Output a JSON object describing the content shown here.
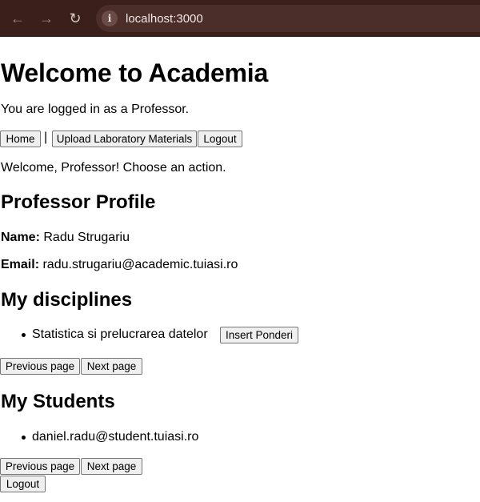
{
  "browser": {
    "url": "localhost:3000",
    "back_icon": "arrow-left-icon",
    "forward_icon": "arrow-right-icon",
    "reload_icon": "reload-icon",
    "info_icon": "info-icon"
  },
  "header": {
    "title": "Welcome to Academia",
    "logged_in_text": "You are logged in as a Professor."
  },
  "nav": {
    "home_label": "Home",
    "separator": "|",
    "upload_label": "Upload Laboratory Materials",
    "logout_label": "Logout"
  },
  "welcome_message": "Welcome, Professor! Choose an action.",
  "profile": {
    "heading": "Professor Profile",
    "name_label": "Name:",
    "name_value": "Radu Strugariu",
    "email_label": "Email:",
    "email_value": "radu.strugariu@academic.tuiasi.ro"
  },
  "disciplines": {
    "heading": "My disciplines",
    "items": [
      {
        "name": "Statistica si prelucrarea datelor",
        "action_label": "Insert Ponderi"
      }
    ],
    "prev_label": "Previous page",
    "next_label": "Next page"
  },
  "students": {
    "heading": "My Students",
    "items": [
      "daniel.radu@student.tuiasi.ro"
    ],
    "prev_label": "Previous page",
    "next_label": "Next page"
  },
  "footer": {
    "logout_label": "Logout"
  }
}
